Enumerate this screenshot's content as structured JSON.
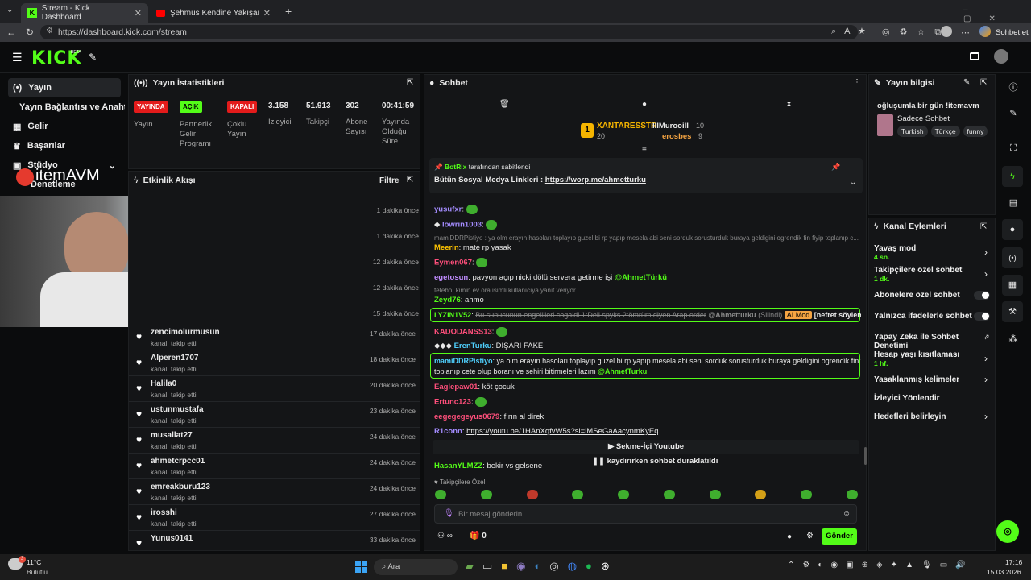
{
  "browser": {
    "tab1": "Stream - Kick Dashboard",
    "tab2": "Şehmus Kendine Yakışanı Yapıyor...",
    "url": "https://dashboard.kick.com/stream",
    "profile": "Sohbet et"
  },
  "app": {
    "logo": "KICK",
    "beta": "BETA"
  },
  "sidebar": {
    "items": [
      "Yayın",
      "Yayın Bağlantısı ve Anahtarı",
      "Gelir",
      "Başarılar",
      "Stüdyo",
      "Denetleme"
    ]
  },
  "overlay": {
    "brand": "itemAVM"
  },
  "stats": {
    "title": "Yayın İstatistikleri",
    "badges": [
      "YAYINDA",
      "AÇIK",
      "KAPALI"
    ],
    "badge_labels": [
      "Yayın",
      "Partnerlik Gelir Programı",
      "Çoklu Yayın"
    ],
    "numbers": [
      {
        "value": "3.158",
        "label": "İzleyici"
      },
      {
        "value": "51.913",
        "label": "Takipçi"
      },
      {
        "value": "302",
        "label": "Abone Sayısı"
      },
      {
        "value": "00:41:59",
        "label": "Yayında Olduğu Süre"
      }
    ]
  },
  "feed": {
    "title": "Etkinlik Akışı",
    "filter": "Filtre",
    "sub": "kanalı takip etti",
    "hidden_times": [
      "1 dakika önce",
      "1 dakika önce",
      "12 dakika önce",
      "12 dakika önce",
      "15 dakika önce"
    ],
    "rows": [
      {
        "name": "zencimolurmusun",
        "time": "17 dakika önce"
      },
      {
        "name": "Alperen1707",
        "time": "18 dakika önce"
      },
      {
        "name": "Halila0",
        "time": "20 dakika önce"
      },
      {
        "name": "ustunmustafa",
        "time": "23 dakika önce"
      },
      {
        "name": "musallat27",
        "time": "24 dakika önce"
      },
      {
        "name": "ahmetcrpcc01",
        "time": "24 dakika önce"
      },
      {
        "name": "emreakburu123",
        "time": "24 dakika önce"
      },
      {
        "name": "irosshi",
        "time": "27 dakika önce"
      },
      {
        "name": "Yunus0141",
        "time": "33 dakika önce"
      }
    ]
  },
  "chat": {
    "title": "Sohbet",
    "leaders": {
      "first": "XANTARESSTR",
      "first_count": "20",
      "second": "IlIMurooiII",
      "second_count": "10",
      "third": "erosbes",
      "third_count": "9"
    },
    "pinned": {
      "by": "BotRix",
      "by_suffix": "tarafından sabitlendi",
      "text": "Bütün Sosyal Medya Linkleri :",
      "link": "https://worp.me/ahmetturku"
    },
    "messages": [
      {
        "user": "yusufxr",
        "text": "",
        "color": "#a48cff"
      },
      {
        "user": "lowrin1003",
        "text": "",
        "color": "#a48cff"
      },
      {
        "reply": "mamiDDRPistiyo : ya olm erayın hasoları toplayıp guzel bi rp yapıp mesela abi seni sorduk sorusturduk buraya geldigini ogrendik fin fiyip toplanıp c..."
      },
      {
        "user": "Meerin",
        "text": "mate rp yasak",
        "color": "#ffc400"
      },
      {
        "user": "Eymen067",
        "text": "",
        "color": "#ff4f7b"
      },
      {
        "user": "egetosun",
        "text": "pavyon açıp nicki dölü servera getirme işi",
        "mention": "@AhmetTürkü",
        "color": "#c08cff"
      },
      {
        "reply": "fetebo: kimin ev ora isimli kullanıcıya yanıt veriyor"
      },
      {
        "user": "Zeyd76",
        "text": "ahmo",
        "color": "#53fc18"
      },
      {
        "user": "LYZIN1V52",
        "text": "Bu sunucunun engellileri cogaldi 1:Deli spyks 2:ömrüm diyen Arap order",
        "mention": "@Ahmetturku",
        "deleted": "(Silindi)",
        "tag": "AI Mod",
        "reason": "[nefret söylemleri]",
        "color": "#53fc18"
      },
      {
        "user": "KADODANSS13",
        "text": "",
        "color": "#ff4f7b"
      },
      {
        "user": "ErenTurku",
        "text": "DIŞARI FAKE",
        "color": "#4fd1ff"
      },
      {
        "user": "mamiDDRPistiyo",
        "text": "ya olm erayın hasoları toplayıp guzel bi rp yapıp mesela abi seni sorduk sorusturduk buraya geldigini ogrendik fin fiyip",
        "text2": "toplanıp cete olup boranı ve sehiri bitirmeleri lazım",
        "mention": "@AhmetTurku",
        "color": "#4fd1ff"
      },
      {
        "user": "Eaglepaw01",
        "text": "köt çocuk",
        "color": "#ff4f7b"
      },
      {
        "user": "Ertunc123",
        "text": "",
        "color": "#ff4f7b"
      },
      {
        "user": "eegegegeyus0679",
        "text": "fırın al direk",
        "color": "#ff4f7b"
      },
      {
        "user": "R1conn",
        "text": "",
        "link": "https://youtu.be/1HAnXqfvW5s?si=lMSeGaAacynmKyEq",
        "color": "#a48cff"
      },
      {
        "user": "HasanYLMZZ",
        "text": "bekir vs gelsene",
        "color": "#53fc18"
      }
    ],
    "youtube_btn": "Sekme-İçi Youtube",
    "paused": "kaydırırken sohbet duraklatıldı",
    "followers_only": "Takipçilere Özel",
    "input_placeholder": "Bir mesaj gönderin",
    "count": "0",
    "send": "Gönder"
  },
  "info": {
    "title": "Yayın bilgisi",
    "stream_title": "oğluşumla bir gün !itemavm",
    "category": "Sadece Sohbet",
    "tags": [
      "Turkish",
      "Türkçe",
      "funny"
    ]
  },
  "actions": {
    "title": "Kanal Eylemleri",
    "items": [
      {
        "label": "Yavaş mod",
        "sub": "4 sn.",
        "type": "chev"
      },
      {
        "label": "Takipçilere özel sohbet",
        "sub": "1 dk.",
        "type": "chev"
      },
      {
        "label": "Abonelere özel sohbet",
        "sub": "",
        "type": "toggle"
      },
      {
        "label": "Yalnızca ifadelerle sohbet",
        "sub": "",
        "type": "toggle"
      },
      {
        "label": "Yapay Zeka ile Sohbet Denetimi",
        "sub": "",
        "type": "ext"
      },
      {
        "label": "Hesap yaşı kısıtlaması",
        "sub": "1 hf.",
        "type": "chev"
      },
      {
        "label": "Yasaklanmış kelimeler",
        "sub": "",
        "type": "chev"
      },
      {
        "label": "İzleyici Yönlendir",
        "sub": "",
        "type": "none"
      },
      {
        "label": "Hedefleri belirleyin",
        "sub": "",
        "type": "chev"
      }
    ]
  },
  "taskbar": {
    "weather_temp": "11°C",
    "weather_desc": "Bulutlu",
    "search": "Ara",
    "time": "17:16",
    "date": "15.03.2026",
    "badge": "3"
  }
}
